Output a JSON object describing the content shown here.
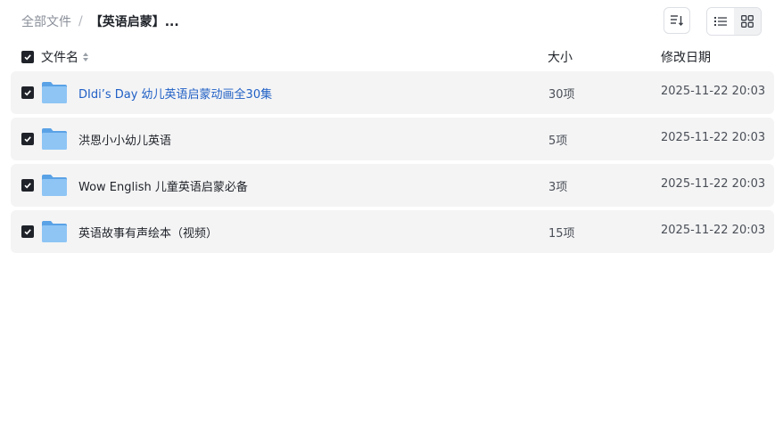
{
  "breadcrumb": {
    "root": "全部文件",
    "separator": "/",
    "current": "【英语启蒙】..."
  },
  "toolbar": {
    "sort_icon": "sort-descending-icon",
    "view_list_icon": "list-view-icon",
    "view_grid_icon": "grid-view-icon"
  },
  "table": {
    "headers": {
      "name": "文件名",
      "size": "大小",
      "modified": "修改日期"
    },
    "rows": [
      {
        "name": "DIdi’s Day 幼儿英语启蒙动画全30集",
        "size": "30项",
        "date": "2025-11-22 20:03",
        "checked": true
      },
      {
        "name": "洪恩小小幼儿英语",
        "size": "5项",
        "date": "2025-11-22 20:03",
        "checked": true
      },
      {
        "name": "Wow English 儿童英语启蒙必备",
        "size": "3项",
        "date": "2025-11-22 20:03",
        "checked": true
      },
      {
        "name": "英语故事有声绘本（视频）",
        "size": "15项",
        "date": "2025-11-22 20:03",
        "checked": true
      }
    ]
  },
  "colors": {
    "link": "#1f5fc5",
    "row_bg": "#f4f4f5",
    "checkbox": "#1f2329",
    "folder": "#7cb8f0"
  }
}
